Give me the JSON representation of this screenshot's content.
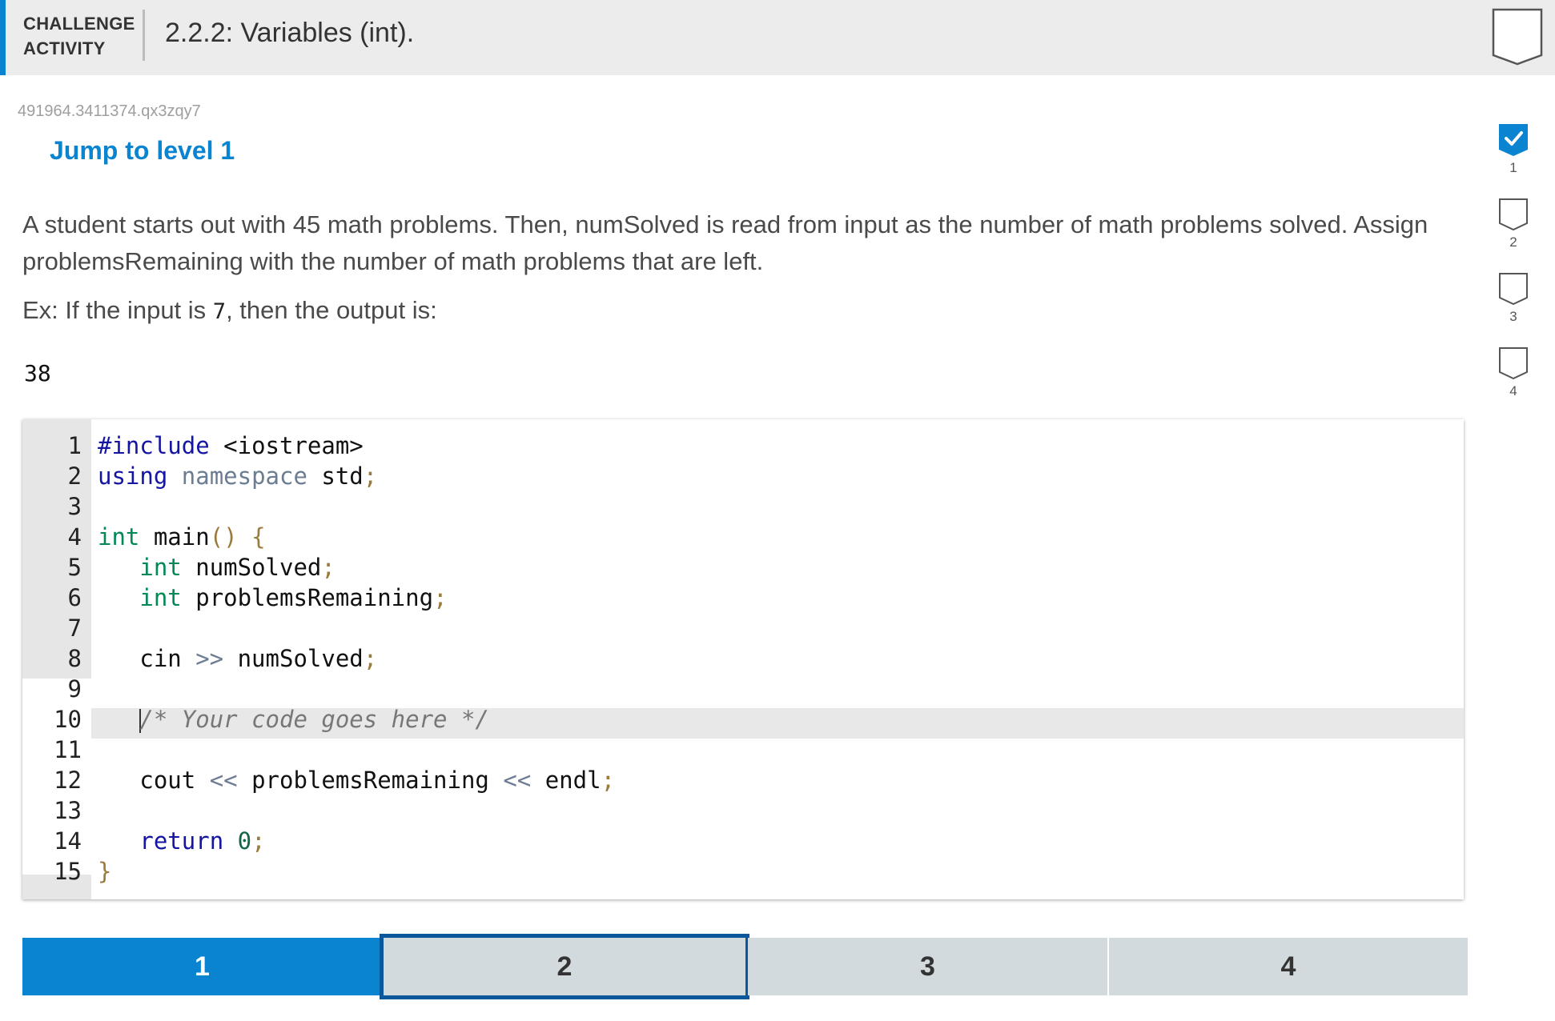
{
  "header": {
    "label_line1": "CHALLENGE",
    "label_line2": "ACTIVITY",
    "title": "2.2.2: Variables (int).",
    "badge_icon": "shield-outline-icon"
  },
  "activity_id": "491964.3411374.qx3zqy7",
  "jump_link": "Jump to level 1",
  "prompt": "A student starts out with 45 math problems. Then, numSolved is read from input as the number of math problems solved. Assign problemsRemaining with the number of math problems that are left.",
  "example": {
    "prefix": "Ex: If the input is ",
    "input_value": "7",
    "suffix": ", then the output is:",
    "output": "38"
  },
  "editor": {
    "line_numbers": [
      "1",
      "2",
      "3",
      "4",
      "5",
      "6",
      "7",
      "8",
      "9",
      "10",
      "11",
      "12",
      "13",
      "14",
      "15"
    ],
    "active_line": 10
  },
  "levels": {
    "items": [
      "1",
      "2",
      "3",
      "4"
    ],
    "completed": [
      "1"
    ],
    "current": "2"
  },
  "progress_steps": [
    {
      "label": "1",
      "status": "complete",
      "icon": "checkmark-icon"
    },
    {
      "label": "2",
      "status": "incomplete",
      "icon": "shield-outline-icon"
    },
    {
      "label": "3",
      "status": "incomplete",
      "icon": "shield-outline-icon"
    },
    {
      "label": "4",
      "status": "incomplete",
      "icon": "shield-outline-icon"
    }
  ],
  "colors": {
    "accent": "#0a83d0",
    "current_level_border": "#0b579c",
    "level_inactive": "#d2dadd"
  }
}
